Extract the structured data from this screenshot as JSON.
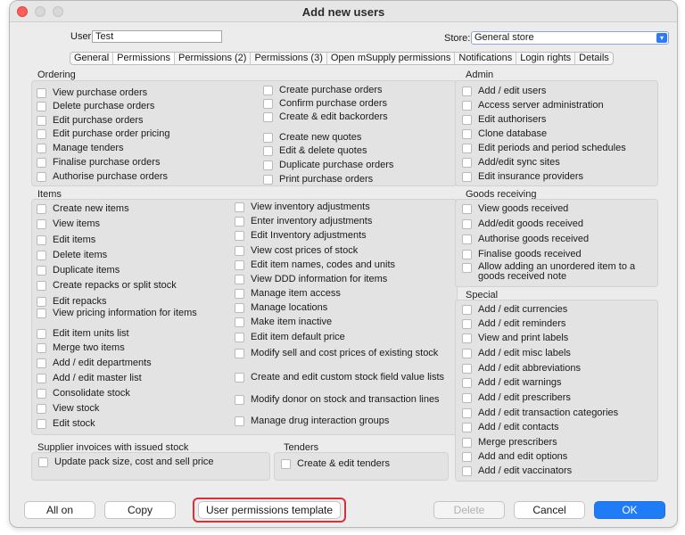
{
  "window": {
    "title": "Add new users"
  },
  "form": {
    "user_label": "User",
    "user_value": "Test",
    "store_label": "Store:",
    "store_value": "General store"
  },
  "tabs": [
    {
      "label": "General",
      "active": false
    },
    {
      "label": "Permissions",
      "active": true
    },
    {
      "label": "Permissions (2)",
      "active": false
    },
    {
      "label": "Permissions (3)",
      "active": false
    },
    {
      "label": "Open mSupply permissions",
      "active": false
    },
    {
      "label": "Notifications",
      "active": false
    },
    {
      "label": "Login rights",
      "active": false
    },
    {
      "label": "Details",
      "active": false
    }
  ],
  "groups": {
    "ordering": {
      "title": "Ordering",
      "left": [
        "View purchase orders",
        "Delete purchase orders",
        "Edit purchase orders",
        "Edit purchase order pricing",
        "Manage tenders",
        "Finalise purchase orders",
        "Authorise purchase orders"
      ],
      "right": [
        "Create purchase orders",
        "Confirm purchase orders",
        "Create & edit backorders",
        "Create new quotes",
        "Edit & delete quotes",
        "Duplicate purchase orders",
        "Print purchase orders"
      ]
    },
    "admin": {
      "title": "Admin",
      "items": [
        "Add / edit users",
        "Access server administration",
        "Edit authorisers",
        "Clone database",
        "Edit periods and period schedules",
        "Add/edit sync sites",
        "Edit insurance providers"
      ]
    },
    "items": {
      "title": "Items",
      "left": [
        "Create new items",
        "View items",
        "Edit items",
        "Delete items",
        "Duplicate items",
        "Create repacks or split stock",
        "Edit repacks",
        "View pricing information for items",
        "Edit item units list",
        "Merge two items",
        "Add / edit departments",
        "Add / edit master list",
        "Consolidate stock",
        "View stock",
        "Edit stock"
      ],
      "right": [
        "View inventory adjustments",
        "Enter inventory adjustments",
        "Edit Inventory adjustments",
        "View cost prices of stock",
        "Edit item names, codes and units",
        "View DDD information for items",
        "Manage item access",
        "Manage locations",
        "Make item inactive",
        "Edit item default price",
        "Modify sell and cost prices of existing stock",
        "Create and edit custom stock field value lists",
        "Modify donor on stock and transaction lines",
        "Manage drug interaction groups"
      ]
    },
    "goods_receiving": {
      "title": "Goods receiving",
      "items": [
        "View goods received",
        "Add/edit goods received",
        "Authorise goods received",
        "Finalise goods received",
        "Allow adding an unordered item to a goods received note"
      ]
    },
    "special": {
      "title": "Special",
      "items": [
        "Add / edit currencies",
        "Add / edit reminders",
        "View and print labels",
        "Add / edit misc labels",
        "Add / edit abbreviations",
        "Add / edit warnings",
        "Add / edit prescribers",
        "Add / edit transaction categories",
        "Add / edit contacts",
        "Merge prescribers",
        "Add and edit options",
        "Add / edit vaccinators"
      ]
    },
    "supplier_invoices": {
      "title": "Supplier invoices with issued stock",
      "items": [
        "Update pack size, cost and sell price"
      ]
    },
    "tenders": {
      "title": "Tenders",
      "items": [
        "Create & edit tenders"
      ]
    }
  },
  "buttons": {
    "all_on": "All on",
    "copy": "Copy",
    "template": "User permissions template",
    "delete": "Delete",
    "cancel": "Cancel",
    "ok": "OK"
  },
  "colors": {
    "accent": "#1f7cf6",
    "highlight": "#d6313a"
  }
}
